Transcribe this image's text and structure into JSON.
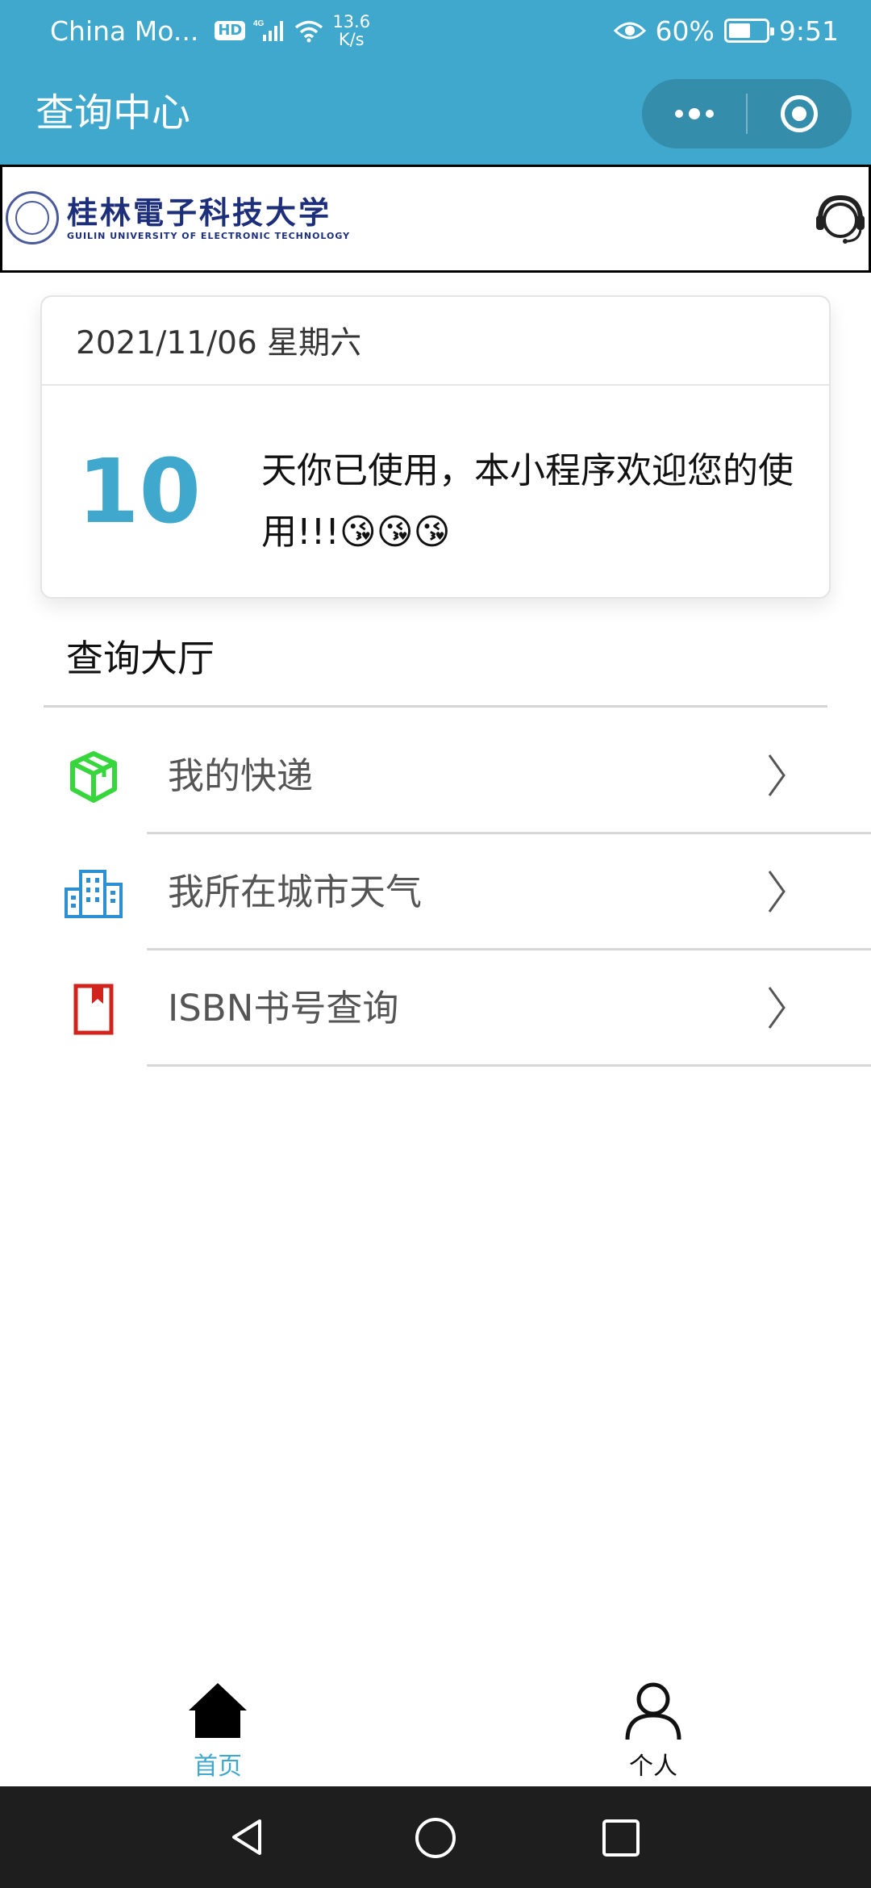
{
  "status_bar": {
    "carrier": "China Mo...",
    "hd_badge": "HD",
    "network": "4G",
    "speed_value": "13.6",
    "speed_unit": "K/s",
    "battery_percent": "60%",
    "battery_level": 0.6,
    "time": "9:51"
  },
  "nav": {
    "title": "查询中心"
  },
  "banner": {
    "logo_cn": "桂林電子科技大学",
    "logo_en": "GUILIN UNIVERSITY OF ELECTRONIC TECHNOLOGY"
  },
  "usage_card": {
    "date": "2021/11/06 星期六",
    "days": "10",
    "message": "天你已使用，本小程序欢迎您的使用!!!😘😘😘"
  },
  "section": {
    "title": "查询大厅",
    "items": [
      {
        "label": "我的快递",
        "icon": "package-icon",
        "color": "#37d63c"
      },
      {
        "label": "我所在城市天气",
        "icon": "city-buildings-icon",
        "color": "#2b8fd2"
      },
      {
        "label": "ISBN书号查询",
        "icon": "book-icon",
        "color": "#d0241c"
      }
    ]
  },
  "tabbar": {
    "home_label": "首页",
    "profile_label": "个人",
    "active_color": "#3fa8cc"
  },
  "colors": {
    "primary": "#3fa8cc",
    "nav_bar_dark": "#1e1e1e"
  }
}
